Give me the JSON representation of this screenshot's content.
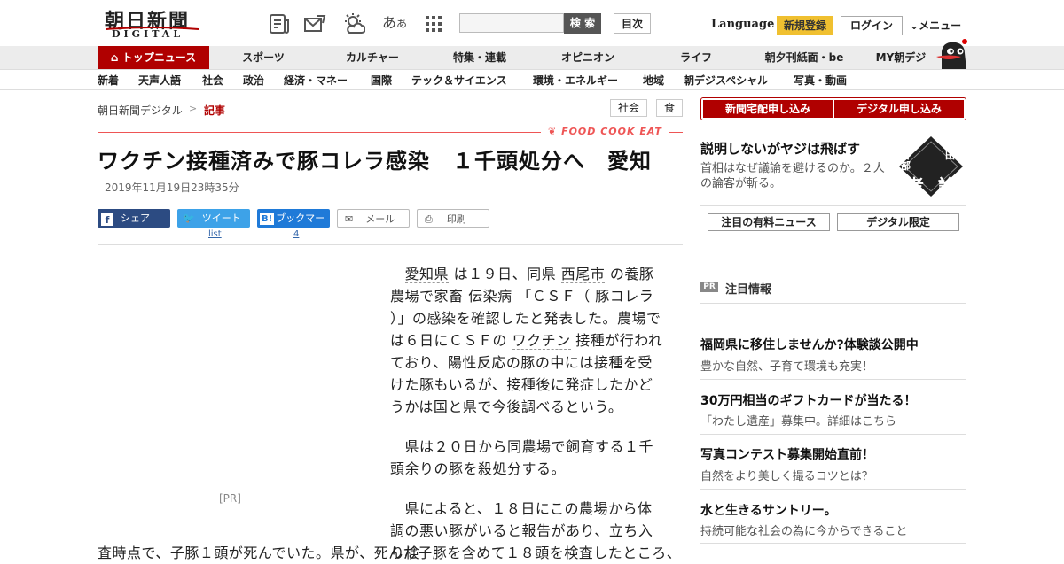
{
  "header": {
    "logo_text": "朝日新聞",
    "logo_sub": "DIGITAL",
    "icons": [
      "newspaper-icon",
      "mail-edit-icon",
      "weather-icon",
      "font-size-icon",
      "grid-menu-icon"
    ],
    "font_icon_label": "あ",
    "font_icon_small": "あ",
    "search_label": "検 索",
    "search_placeholder": "",
    "toc_label": "目次",
    "language_label": "Language",
    "register_label": "新規登録",
    "login_label": "ログイン",
    "menu_label": "メニュー"
  },
  "nav_primary": [
    "トップニュース",
    "スポーツ",
    "カルチャー",
    "特集・連載",
    "オピニオン",
    "ライフ",
    "朝夕刊紙面・be",
    "MY朝デジ"
  ],
  "nav_secondary": [
    "新着",
    "天声人語",
    "社会",
    "政治",
    "経済・マネー",
    "国際",
    "テック＆サイエンス",
    "環境・エネルギー",
    "地域",
    "朝デジスペシャル",
    "写真・動画"
  ],
  "breadcrumb": {
    "home": "朝日新聞デジタル",
    "separator": ">",
    "current": "記事"
  },
  "tags": [
    "社会",
    "食"
  ],
  "food_banner": "FOOD COOK EAT",
  "article": {
    "title": "ワクチン接種済みで豚コレラ感染　１千頭処分へ　愛知",
    "date": "2019年11月19日23時35分",
    "share": {
      "facebook": "シェア",
      "twitter": "ツイート",
      "hatena": "ブックマーク",
      "mail": "メール",
      "print": "印刷",
      "twitter_count": "list",
      "hatena_count": "4"
    },
    "ad_label": "[PR]",
    "para1": {
      "pre": "　",
      "kw1": "愛知県",
      "t1": " は１９日、同県 ",
      "kw2": "西尾市",
      "t2": " の養豚農場で家畜 ",
      "kw3": "伝染病",
      "t3": " 「ＣＳＦ（ ",
      "kw4": "豚コレラ",
      "t4": " ）」の感染を確認したと発表した。農場では６日にＣＳＦの ",
      "kw5": "ワクチン",
      "t5": " 接種が行われており、陽性反応の豚の中には接種を受けた豚もいるが、接種後に発症したかどうかは国と県で今後調べるという。"
    },
    "para2": "　県は２０日から同農場で飼育する１千頭余りの豚を殺処分する。",
    "para3_start": "　県によると、１８日にこの農場から体調の悪い豚がいると報告があり、立ち入り検",
    "para3_cont": "査時点で、子豚１頭が死んでいた。県が、死んだ子豚を含めて１８頭を検査したところ、"
  },
  "sidebar": {
    "subscribe_paper": "新聞宅配申し込み",
    "subscribe_digital": "デジタル申し込み",
    "opinion_title": "説明しないがヤジは飛ばす",
    "opinion_desc": "首相はなぜ議論を避けるのか。２人の論客が斬る。",
    "emblem_text": [
      "長谷部",
      "杉田",
      "考",
      "論"
    ],
    "tab_paid": "注目の有料ニュース",
    "tab_digital": "デジタル限定",
    "pr_badge": "PR",
    "pr_heading": "注目情報",
    "pr_items": [
      {
        "title": "福岡県に移住しませんか?体験談公開中",
        "desc": "豊かな自然、子育て環境も充実！"
      },
      {
        "title": "30万円相当のギフトカードが当たる！",
        "desc": "「わたし遺産」募集中。詳細はこちら"
      },
      {
        "title": "写真コンテスト募集開始直前！",
        "desc": "自然をより美しく撮るコツとは？"
      },
      {
        "title": "水と生きるサントリー。",
        "desc": "持続可能な社会の為に今からできること"
      }
    ]
  }
}
